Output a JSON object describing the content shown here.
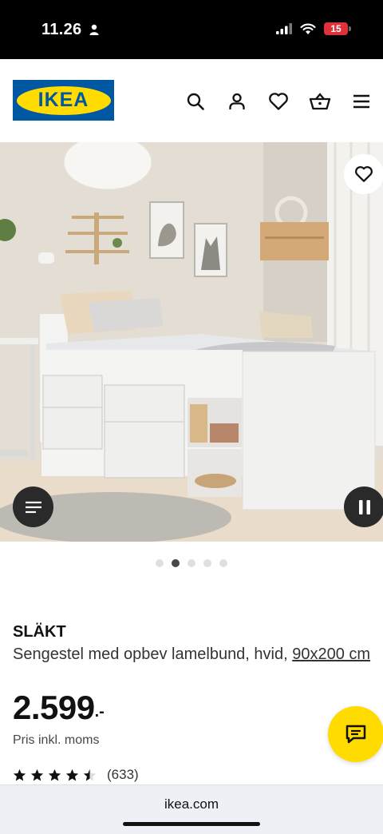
{
  "status_bar": {
    "time": "11.26",
    "battery": "15",
    "battery_color": "#e0303a"
  },
  "header": {
    "logo_text": "IKEA",
    "logo_colors": {
      "blue": "#0058a3",
      "yellow": "#ffdb00"
    },
    "icons": [
      "search-icon",
      "account-icon",
      "heart-icon",
      "basket-icon",
      "hamburger-menu-icon"
    ]
  },
  "hero": {
    "slide_count": 5,
    "active_slide": 2,
    "icons": [
      "heart-icon",
      "menu-lines-icon",
      "pause-icon"
    ]
  },
  "product": {
    "name": "SLÄKT",
    "description": "Sengestel med opbev lamelbund, hvid, ",
    "size_link": "90x200 cm",
    "price": "2.599",
    "price_suffix": ".-",
    "price_note": "Pris inkl. moms",
    "rating": 4.5,
    "rating_max": 5,
    "review_count": "(633)"
  },
  "chat": {
    "icon": "chat-bubble-icon",
    "color": "#ffdb00"
  },
  "browser": {
    "url": "ikea.com"
  }
}
